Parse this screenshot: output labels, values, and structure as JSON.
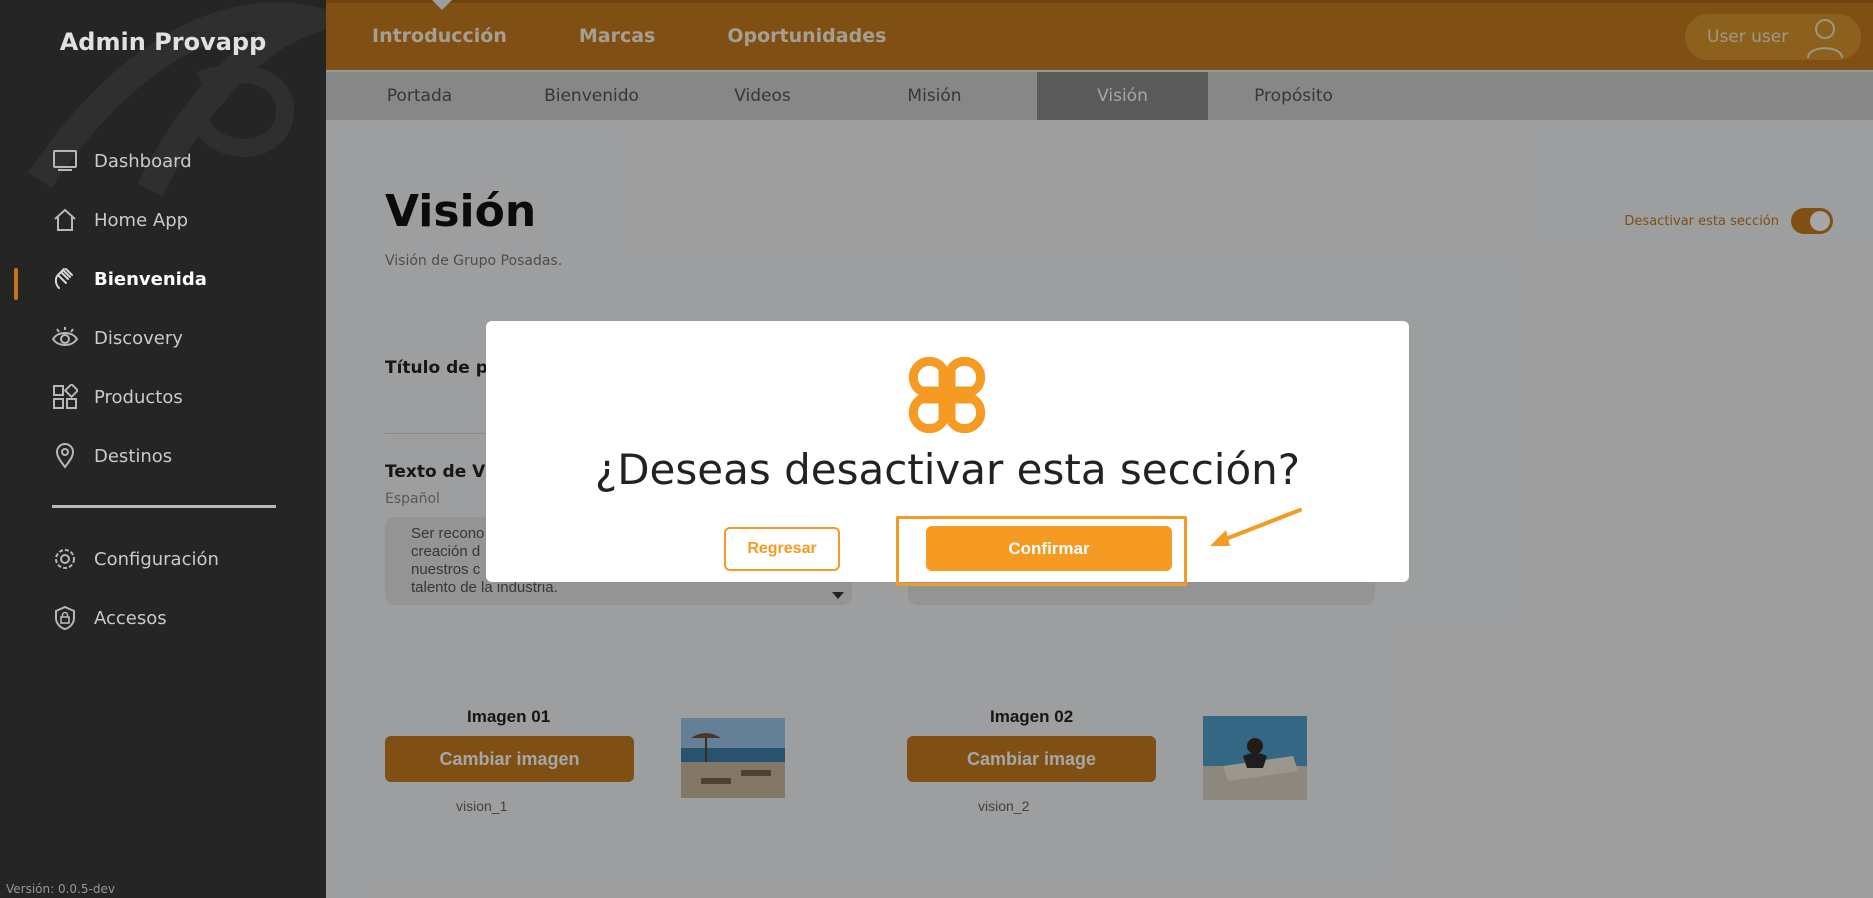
{
  "sidebar": {
    "brand": "Admin Provapp",
    "items": [
      {
        "label": "Dashboard",
        "icon": "monitor-icon"
      },
      {
        "label": "Home App",
        "icon": "home-icon"
      },
      {
        "label": "Bienvenida",
        "icon": "wave-hand-icon",
        "active": true
      },
      {
        "label": "Discovery",
        "icon": "eye-icon"
      },
      {
        "label": "Productos",
        "icon": "grid-shapes-icon"
      },
      {
        "label": "Destinos",
        "icon": "map-pin-icon"
      }
    ],
    "bottom_items": [
      {
        "label": "Configuración",
        "icon": "gear-icon"
      },
      {
        "label": "Accesos",
        "icon": "shield-lock-icon"
      }
    ],
    "version": "Versión: 0.0.5-dev"
  },
  "topnav": {
    "items": [
      "Introducción",
      "Marcas",
      "Oportunidades"
    ],
    "user_label": "User user"
  },
  "subnav": {
    "tabs": [
      "Portada",
      "Bienvenido",
      "Videos",
      "Misión",
      "Visión",
      "Propósito"
    ],
    "active": "Visión"
  },
  "page": {
    "title": "Visión",
    "subtitle": "Visión de Grupo Posadas.",
    "toggle_label": "Desactivar esta sección",
    "field_title_label": "Título de pág",
    "field_text_label": "Texto de Visi",
    "lang_label": "Español",
    "textarea_lines": [
      "Ser recono",
      "creación d",
      "nuestros c",
      "talento de la industria."
    ],
    "images": [
      {
        "label": "Imagen 01",
        "button": "Cambiar imagen",
        "file": "vision_1"
      },
      {
        "label": "Imagen 02",
        "button": "Cambiar image",
        "file": "vision_2"
      }
    ]
  },
  "modal": {
    "question": "¿Deseas desactivar esta sección?",
    "back_label": "Regresar",
    "confirm_label": "Confirmar",
    "accent": "#f59a23"
  },
  "colors": {
    "brand": "#c47a1f",
    "sidebar_bg": "#262626",
    "accent": "#f59a23"
  }
}
